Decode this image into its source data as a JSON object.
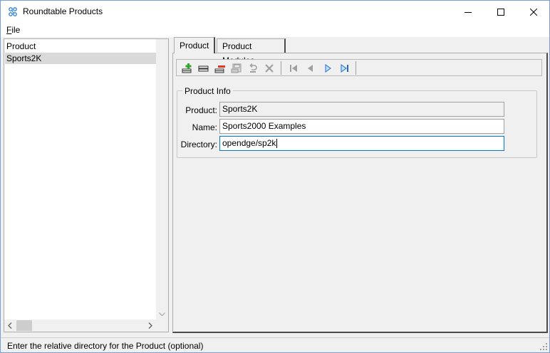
{
  "window": {
    "title": "Roundtable Products",
    "accent_color": "#0078d7"
  },
  "menu": {
    "file_label": "File",
    "file_mnemonic": "F",
    "file_rest": "ile"
  },
  "left_list": {
    "items": [
      "Product",
      "Sports2K"
    ],
    "selected_index": 1
  },
  "tabs": [
    {
      "label": "Product",
      "active": true
    },
    {
      "label": "Product Modules",
      "active": false
    }
  ],
  "toolbar": {
    "buttons": [
      {
        "icon": "add-record-icon",
        "enabled": true
      },
      {
        "icon": "copy-record-icon",
        "enabled": true
      },
      {
        "icon": "delete-record-icon",
        "enabled": true
      },
      {
        "icon": "save-record-icon",
        "enabled": false
      },
      {
        "icon": "undo-icon",
        "enabled": false
      },
      {
        "icon": "cancel-icon",
        "enabled": false
      },
      {
        "icon": "first-record-icon",
        "enabled": false
      },
      {
        "icon": "previous-record-icon",
        "enabled": false
      },
      {
        "icon": "next-record-icon",
        "enabled": true
      },
      {
        "icon": "last-record-icon",
        "enabled": true
      }
    ]
  },
  "product_info": {
    "group_title": "Product Info",
    "product_label": "Product:",
    "product_value": "Sports2K",
    "name_label": "Name:",
    "name_value": "Sports2000 Examples",
    "directory_label": "Directory:",
    "directory_value": "opendge/sp2k"
  },
  "status": {
    "text": "Enter the relative directory for the Product (optional)"
  }
}
